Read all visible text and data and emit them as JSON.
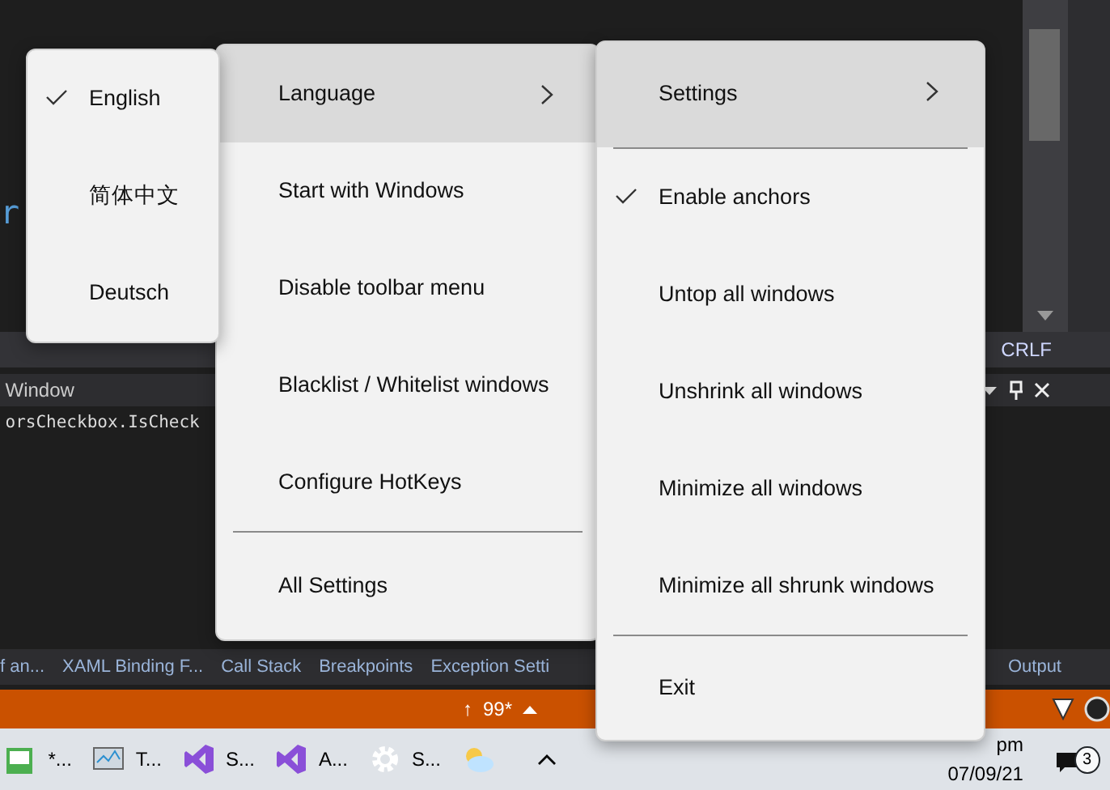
{
  "editor": {
    "code_fragment": "r",
    "line_ending": "CRLF"
  },
  "output_window": {
    "title": "Window",
    "code_line": "orsCheckbox.IsCheck"
  },
  "tool_tabs": [
    {
      "label": "f an..."
    },
    {
      "label": "XAML Binding F..."
    },
    {
      "label": "Call Stack"
    },
    {
      "label": "Breakpoints"
    },
    {
      "label": "Exception Setti"
    },
    {
      "label": "Output"
    }
  ],
  "status_bar": {
    "arrow": "↑",
    "count": "99*"
  },
  "taskbar": {
    "apps": [
      {
        "kind": "notepad",
        "label": "*..."
      },
      {
        "kind": "monitor",
        "label": "T..."
      },
      {
        "kind": "vs",
        "label": "S..."
      },
      {
        "kind": "vs",
        "label": "A..."
      },
      {
        "kind": "gear",
        "label": "S..."
      },
      {
        "kind": "cloud"
      }
    ],
    "time": "pm",
    "date": "07/09/21",
    "notifications": "3"
  },
  "menus": [
    {
      "kind": "language",
      "items": [
        {
          "kind": "item",
          "label": "English",
          "selected": false,
          "checked": true,
          "submenu": false
        },
        {
          "kind": "item",
          "label": "简体中文",
          "selected": false,
          "checked": false,
          "submenu": false
        },
        {
          "kind": "item",
          "label": "Deutsch",
          "selected": false,
          "checked": false,
          "submenu": false
        }
      ]
    },
    {
      "kind": "main",
      "items": [
        {
          "kind": "item",
          "label": "Language",
          "selected": true,
          "checked": false,
          "submenu": true
        },
        {
          "kind": "item",
          "label": "Start with Windows",
          "selected": false,
          "checked": false,
          "submenu": false
        },
        {
          "kind": "item",
          "label": "Disable toolbar menu",
          "selected": false,
          "checked": false,
          "submenu": false
        },
        {
          "kind": "item",
          "label": "Blacklist / Whitelist windows",
          "selected": false,
          "checked": false,
          "submenu": false
        },
        {
          "kind": "item",
          "label": "Configure HotKeys",
          "selected": false,
          "checked": false,
          "submenu": false
        },
        {
          "kind": "separator"
        },
        {
          "kind": "item",
          "label": "All Settings",
          "selected": false,
          "checked": false,
          "submenu": false
        }
      ]
    },
    {
      "kind": "tray",
      "items": [
        {
          "kind": "item",
          "label": "Settings",
          "selected": true,
          "checked": false,
          "submenu": true
        },
        {
          "kind": "separator"
        },
        {
          "kind": "item",
          "label": "Enable anchors",
          "selected": false,
          "checked": true,
          "submenu": false
        },
        {
          "kind": "item",
          "label": "Untop all windows",
          "selected": false,
          "checked": false,
          "submenu": false
        },
        {
          "kind": "item",
          "label": "Unshrink all windows",
          "selected": false,
          "checked": false,
          "submenu": false
        },
        {
          "kind": "item",
          "label": "Minimize all windows",
          "selected": false,
          "checked": false,
          "submenu": false
        },
        {
          "kind": "item",
          "label": "Minimize all shrunk windows",
          "selected": false,
          "checked": false,
          "submenu": false
        },
        {
          "kind": "separator"
        },
        {
          "kind": "item",
          "label": "Exit",
          "selected": false,
          "checked": false,
          "submenu": false
        }
      ]
    }
  ]
}
